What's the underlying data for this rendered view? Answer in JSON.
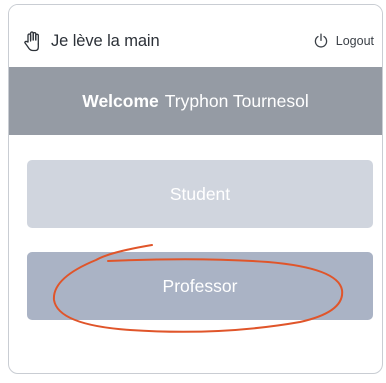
{
  "app": {
    "title": "Je lève la main",
    "logo_icon": "raised-hand-icon"
  },
  "header": {
    "logout_label": "Logout",
    "logout_icon": "power-icon"
  },
  "welcome": {
    "greeting": "Welcome",
    "user_name": "Tryphon Tournesol"
  },
  "roles": {
    "student_label": "Student",
    "professor_label": "Professor"
  },
  "annotation": {
    "color": "#e0552a",
    "shape": "hand-drawn ellipse around Professor button"
  }
}
